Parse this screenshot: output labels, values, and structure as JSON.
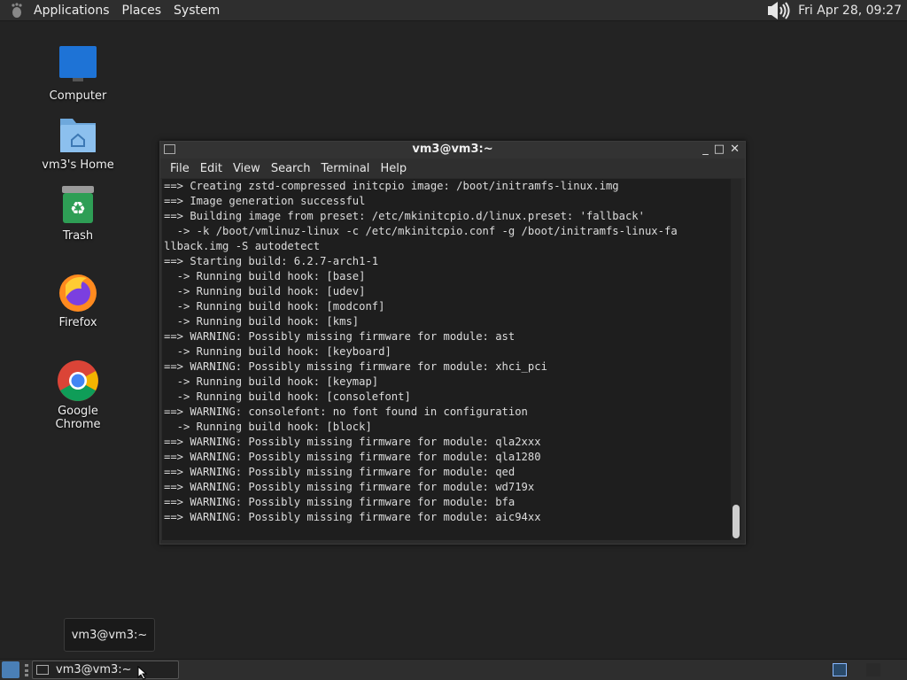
{
  "top_panel": {
    "menus": [
      "Applications",
      "Places",
      "System"
    ],
    "clock": "Fri Apr 28, 09:27",
    "icons": [
      "gnome-foot-icon",
      "volume-icon"
    ]
  },
  "desktop_icons": [
    {
      "label": "Computer",
      "icon": "computer-icon"
    },
    {
      "label": "vm3's Home",
      "icon": "home-folder-icon"
    },
    {
      "label": "Trash",
      "icon": "trash-icon"
    },
    {
      "label": "Firefox",
      "icon": "firefox-icon"
    },
    {
      "label": "Google Chrome",
      "icon": "chrome-icon"
    }
  ],
  "terminal": {
    "title": "vm3@vm3:~",
    "window_buttons": [
      "_",
      "□",
      "✕"
    ],
    "menu": [
      "File",
      "Edit",
      "View",
      "Search",
      "Terminal",
      "Help"
    ],
    "lines": [
      "==> Creating zstd-compressed initcpio image: /boot/initramfs-linux.img",
      "==> Image generation successful",
      "==> Building image from preset: /etc/mkinitcpio.d/linux.preset: 'fallback'",
      "  -> -k /boot/vmlinuz-linux -c /etc/mkinitcpio.conf -g /boot/initramfs-linux-fa",
      "llback.img -S autodetect",
      "==> Starting build: 6.2.7-arch1-1",
      "  -> Running build hook: [base]",
      "  -> Running build hook: [udev]",
      "  -> Running build hook: [modconf]",
      "  -> Running build hook: [kms]",
      "==> WARNING: Possibly missing firmware for module: ast",
      "  -> Running build hook: [keyboard]",
      "==> WARNING: Possibly missing firmware for module: xhci_pci",
      "  -> Running build hook: [keymap]",
      "  -> Running build hook: [consolefont]",
      "==> WARNING: consolefont: no font found in configuration",
      "  -> Running build hook: [block]",
      "==> WARNING: Possibly missing firmware for module: qla2xxx",
      "==> WARNING: Possibly missing firmware for module: qla1280",
      "==> WARNING: Possibly missing firmware for module: qed",
      "==> WARNING: Possibly missing firmware for module: wd719x",
      "==> WARNING: Possibly missing firmware for module: bfa",
      "==> WARNING: Possibly missing firmware for module: aic94xx"
    ]
  },
  "tooltip": {
    "text": "vm3@vm3:~"
  },
  "taskbar": {
    "task_label": "vm3@vm3:~",
    "icons": [
      "show-desktop-icon",
      "terminal-icon",
      "workspace-switcher-icon"
    ]
  },
  "colors": {
    "desktop_bg": "#232323",
    "panel_bg": "#2e2e2e",
    "terminal_bg": "#1e1e1e",
    "terminal_fg": "#dcdcdc",
    "accent": "#4a7fb6"
  }
}
